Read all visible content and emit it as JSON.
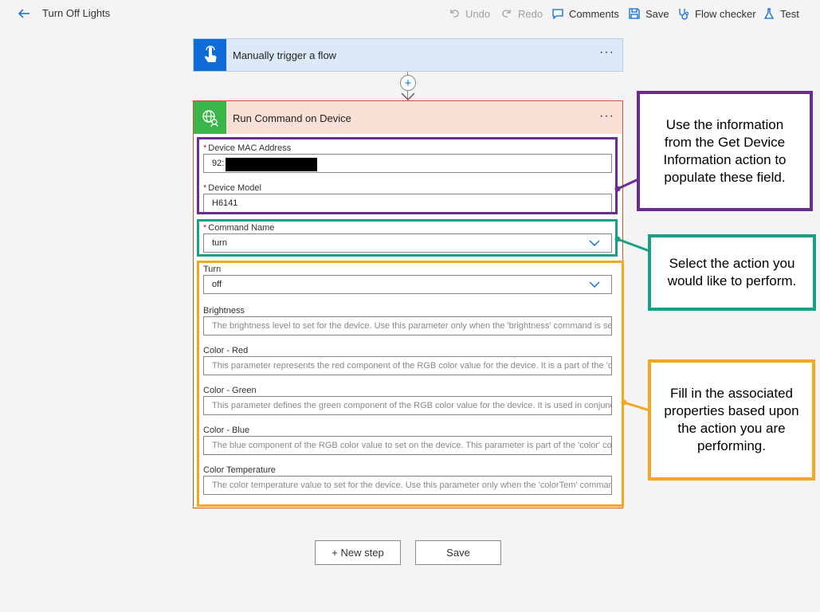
{
  "header": {
    "title": "Turn Off Lights",
    "commands": {
      "undo": "Undo",
      "redo": "Redo",
      "comments": "Comments",
      "save": "Save",
      "flow_checker": "Flow checker",
      "test": "Test"
    }
  },
  "trigger": {
    "title": "Manually trigger a flow",
    "icon": "touch-icon",
    "color": "#0f6cd6"
  },
  "action": {
    "title": "Run Command on Device",
    "icon": "globe-device-icon",
    "color": "#3ab54a",
    "fields": {
      "mac": {
        "label": "Device MAC Address",
        "value": "92:"
      },
      "model": {
        "label": "Device Model",
        "value": "H6141"
      },
      "command": {
        "label": "Command Name",
        "value": "turn"
      },
      "turn": {
        "label": "Turn",
        "value": "off"
      },
      "brightness": {
        "label": "Brightness",
        "placeholder": "The brightness level to set for the device. Use this parameter only when the 'brightness' command is sel"
      },
      "red": {
        "label": "Color - Red",
        "placeholder": "This parameter represents the red component of the RGB color value for the device. It is a part of the 'cc"
      },
      "green": {
        "label": "Color - Green",
        "placeholder": "This parameter defines the green component of the RGB color value for the device. It is used in conjunc"
      },
      "blue": {
        "label": "Color - Blue",
        "placeholder": "The blue component of the RGB color value to set on the device. This parameter is part of the 'color' cor"
      },
      "temp": {
        "label": "Color Temperature",
        "placeholder": "The color temperature value to set for the device. Use this parameter only when the 'colorTem' comman"
      }
    }
  },
  "callouts": {
    "purple": "Use the information from the Get Device Information action to populate these field.",
    "teal": "Select the action you would like to perform.",
    "orange": "Fill in the associated properties based upon the action you are performing."
  },
  "footer": {
    "new_step": "+ New step",
    "save": "Save"
  },
  "colors": {
    "purple": "#6a2d8f",
    "teal": "#16a085",
    "orange": "#f5a623",
    "accent": "#0f6cd6"
  }
}
